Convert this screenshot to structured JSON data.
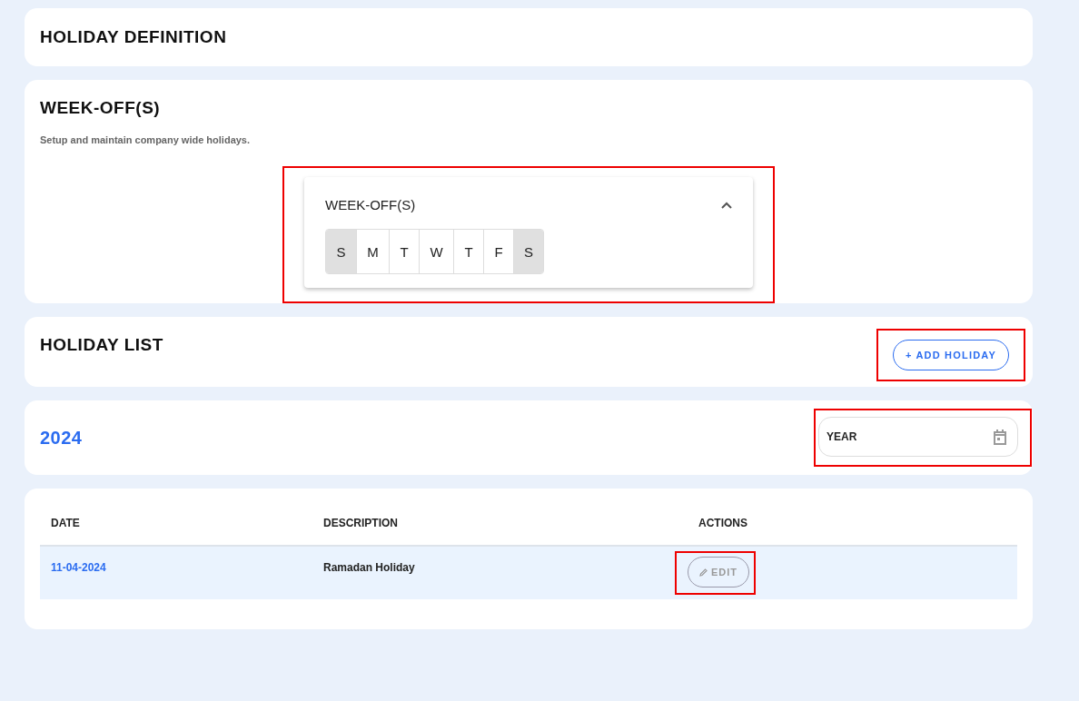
{
  "page_title": "HOLIDAY DEFINITION",
  "weekoff_section": {
    "title": "WEEK-OFF(S)",
    "subtitle": "Setup and maintain company wide holidays.",
    "highlighted": true,
    "panel": {
      "title": "WEEK-OFF(S)",
      "expanded": true,
      "days": [
        {
          "label": "S",
          "selected": true
        },
        {
          "label": "M",
          "selected": false
        },
        {
          "label": "T",
          "selected": false
        },
        {
          "label": "W",
          "selected": false
        },
        {
          "label": "T",
          "selected": false
        },
        {
          "label": "F",
          "selected": false
        },
        {
          "label": "S",
          "selected": true
        }
      ]
    }
  },
  "holiday_list": {
    "title": "HOLIDAY LIST",
    "add_button": {
      "label": "+ ADD HOLIDAY",
      "highlighted": true
    }
  },
  "year_bar": {
    "year": "2024",
    "year_field": {
      "placeholder": "YEAR",
      "highlighted": true
    }
  },
  "table": {
    "columns": [
      "DATE",
      "DESCRIPTION",
      "ACTIONS"
    ],
    "rows": [
      {
        "date": "11-04-2024",
        "description": "Ramadan Holiday",
        "selected": true,
        "action": {
          "label": "EDIT",
          "disabled": true,
          "highlighted": true
        }
      }
    ]
  }
}
